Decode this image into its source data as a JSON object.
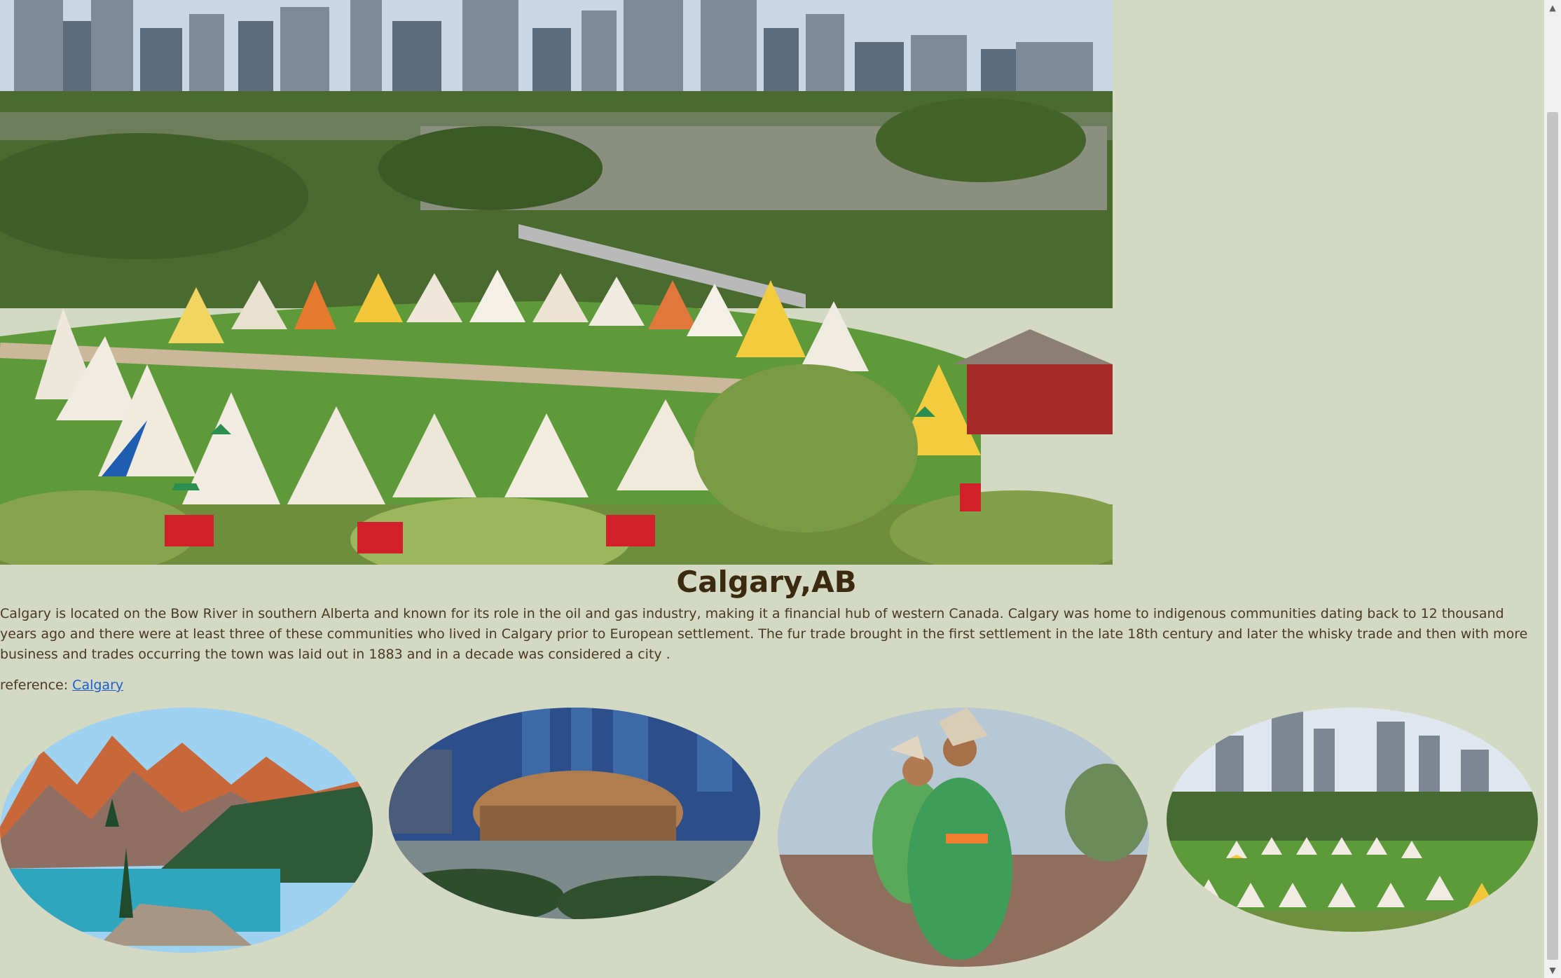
{
  "hero": {
    "image_name": "calgary-tipi-village-skyline"
  },
  "page": {
    "title": "Calgary,AB",
    "description": "Calgary is located on the Bow River in southern Alberta and known for its role in the oil and gas industry, making it a financial hub of western Canada. Calgary was home to indigenous communities dating back to 12 thousand years ago and there were at least three of these communities who lived in Calgary prior to European settlement. The fur trade brought in the first settlement in the late 18th century and later the whisky trade and then with more business and trades occurring the town was laid out in 1883 and in a decade was considered a city .",
    "reference_label": "reference:",
    "reference_link": "Calgary"
  },
  "gallery": {
    "items": [
      {
        "image_name": "moraine-lake-mountains"
      },
      {
        "image_name": "modern-building-plaza"
      },
      {
        "image_name": "indigenous-dancers"
      },
      {
        "image_name": "tipi-village-skyline"
      }
    ]
  },
  "colors": {
    "background": "#d4d9c4",
    "title": "#3b2a10",
    "text": "#4a3a22",
    "link": "#1a5fd0"
  },
  "scrollbar": {
    "up_icon": "arrow-up-icon",
    "down_icon": "arrow-down-icon"
  }
}
